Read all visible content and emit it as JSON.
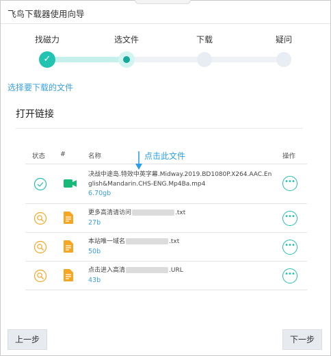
{
  "window": {
    "title": "飞鸟下载器使用向导"
  },
  "steps": [
    {
      "label": "找磁力",
      "state": "done"
    },
    {
      "label": "选文件",
      "state": "current"
    },
    {
      "label": "下载",
      "state": "pending"
    },
    {
      "label": "疑问",
      "state": "pending"
    }
  ],
  "choose_link": "选择要下载的文件",
  "section_title": "打开链接",
  "table": {
    "headers": {
      "status": "状态",
      "index": "#",
      "name": "名称",
      "action": "操作"
    },
    "rows": [
      {
        "status": "check",
        "type": "video",
        "name_line1": "决战中途岛.特效中英字幕.Midway.2019.BD1080P.X264.AAC.En",
        "name_line2": "glish&Mandarin.CHS-ENG.Mp4Ba.mp4",
        "size": "6.70gb"
      },
      {
        "status": "search",
        "type": "doc",
        "name_prefix": "更多高清请访问",
        "name_suffix": ".txt",
        "size": "27b"
      },
      {
        "status": "search",
        "type": "doc",
        "name_prefix": "本站唯一域名",
        "name_suffix": ".txt",
        "size": "50b"
      },
      {
        "status": "search",
        "type": "doc",
        "name_prefix": "点击进入高清",
        "name_suffix": ".URL",
        "size": "43b"
      }
    ]
  },
  "annotation": "点击此文件",
  "buttons": {
    "prev": "上一步",
    "next": "下一步"
  },
  "colors": {
    "accent": "#22c3b0",
    "link": "#3aa0e0",
    "doc_orange": "#f5a623",
    "video_green": "#17b978"
  },
  "icons": {
    "check": "check-circle-icon",
    "search": "search-icon",
    "video": "video-camera-icon",
    "doc": "document-icon",
    "more": "more-dots-icon",
    "arrow": "arrow-down-icon"
  }
}
